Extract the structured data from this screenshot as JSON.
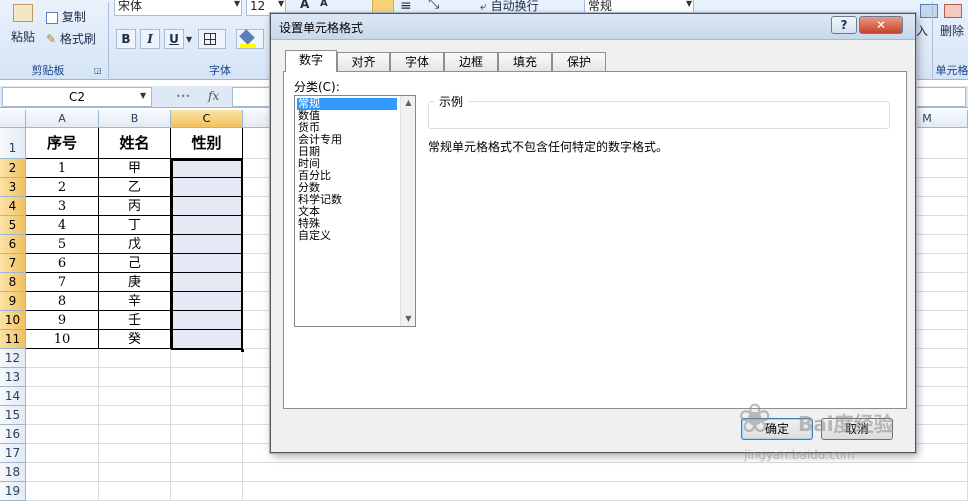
{
  "ribbon": {
    "clipboard": {
      "paste": "粘贴",
      "copy": "复制",
      "format_painter": "格式刷",
      "group": "剪贴板"
    },
    "font": {
      "font_name": "宋体",
      "font_size": "12",
      "bold": "B",
      "italic": "I",
      "underline": "U",
      "group": "字体"
    },
    "alignment": {
      "wrap_text": "自动换行"
    },
    "number": {
      "format": "常规"
    },
    "cells": {
      "delete": "删除",
      "insert_partial": "入",
      "group": "单元格"
    }
  },
  "formula_bar": {
    "name_box": "C2",
    "fx": "fx",
    "value": ""
  },
  "sheet": {
    "columns": [
      "A",
      "B",
      "C"
    ],
    "far_column": "M",
    "rows": [
      "1",
      "2",
      "3",
      "4",
      "5",
      "6",
      "7",
      "8",
      "9",
      "10",
      "11",
      "12",
      "13",
      "14",
      "15",
      "16",
      "17",
      "18",
      "19"
    ],
    "header": [
      "序号",
      "姓名",
      "性别"
    ],
    "data": [
      [
        "1",
        "甲",
        ""
      ],
      [
        "2",
        "乙",
        ""
      ],
      [
        "3",
        "丙",
        ""
      ],
      [
        "4",
        "丁",
        ""
      ],
      [
        "5",
        "戊",
        ""
      ],
      [
        "6",
        "己",
        ""
      ],
      [
        "7",
        "庚",
        ""
      ],
      [
        "8",
        "辛",
        ""
      ],
      [
        "9",
        "壬",
        ""
      ],
      [
        "10",
        "癸",
        ""
      ]
    ]
  },
  "dialog": {
    "title": "设置单元格格式",
    "help": "?",
    "close": "✕",
    "tabs": [
      "数字",
      "对齐",
      "字体",
      "边框",
      "填充",
      "保护"
    ],
    "category_label": "分类(C):",
    "categories": [
      "常规",
      "数值",
      "货币",
      "会计专用",
      "日期",
      "时间",
      "百分比",
      "分数",
      "科学记数",
      "文本",
      "特殊",
      "自定义"
    ],
    "selected_category": "常规",
    "sample_label": "示例",
    "description": "常规单元格格式不包含任何特定的数字格式。",
    "ok": "确定",
    "cancel": "取消"
  },
  "watermark": {
    "text": "Bai度经验",
    "url": "jingyan.baidu.com"
  },
  "colors": {
    "accent": "#3399ff",
    "ribbon_label": "#15428b",
    "selected_header": "#f2c160"
  }
}
